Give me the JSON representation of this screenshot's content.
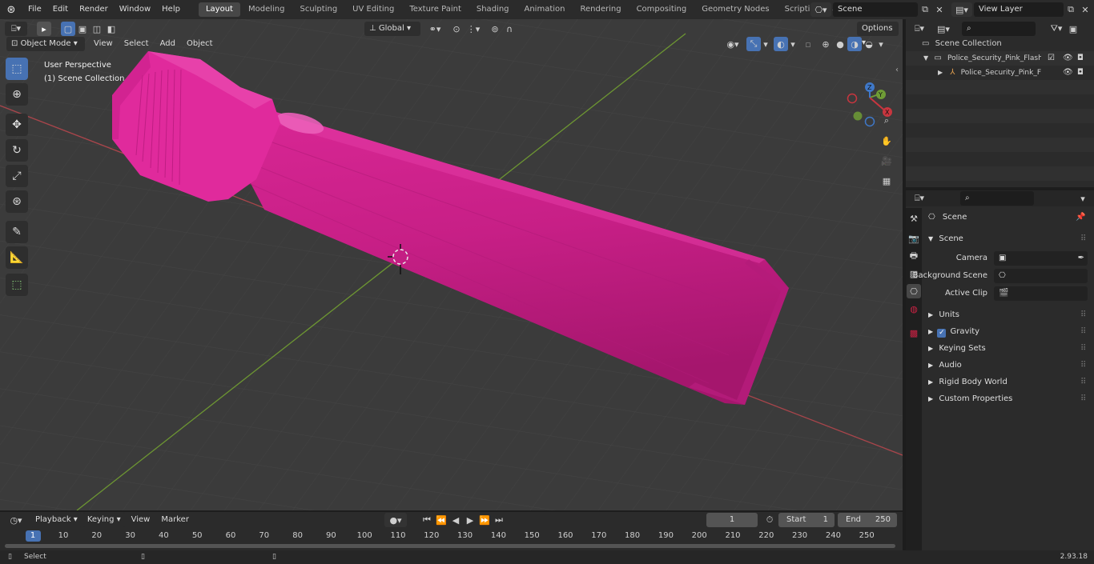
{
  "topbar": {
    "menus": [
      "File",
      "Edit",
      "Render",
      "Window",
      "Help"
    ],
    "workspaces": [
      "Layout",
      "Modeling",
      "Sculpting",
      "UV Editing",
      "Texture Paint",
      "Shading",
      "Animation",
      "Rendering",
      "Compositing",
      "Geometry Nodes",
      "Scripting"
    ],
    "active_workspace": "Layout",
    "scene": "Scene",
    "view_layer": "View Layer"
  },
  "viewport": {
    "mode": "Object Mode",
    "menus": [
      "View",
      "Select",
      "Add",
      "Object"
    ],
    "transform_orientation": "Global",
    "options": "Options",
    "overlay_title": "User Perspective",
    "overlay_subtitle": "(1) Scene Collection",
    "object_color": "#e0279c"
  },
  "outliner": {
    "root": "Scene Collection",
    "items": [
      {
        "label": "Police_Security_Pink_Flashligh"
      },
      {
        "label": "Police_Security_Pink_Flas"
      }
    ]
  },
  "properties": {
    "context_title": "Scene",
    "section_title": "Scene",
    "camera_label": "Camera",
    "background_scene_label": "Background Scene",
    "active_clip_label": "Active Clip",
    "panels": [
      "Units",
      "Gravity",
      "Keying Sets",
      "Audio",
      "Rigid Body World",
      "Custom Properties"
    ]
  },
  "timeline": {
    "menus": [
      "Playback",
      "Keying",
      "View",
      "Marker"
    ],
    "current_frame": "1",
    "start_label": "Start",
    "start_value": "1",
    "end_label": "End",
    "end_value": "250",
    "ticks": [
      "1",
      "10",
      "20",
      "30",
      "40",
      "50",
      "60",
      "70",
      "80",
      "90",
      "100",
      "110",
      "120",
      "130",
      "140",
      "150",
      "160",
      "170",
      "180",
      "190",
      "200",
      "210",
      "220",
      "230",
      "240",
      "250"
    ]
  },
  "status": {
    "left": "Select",
    "version": "2.93.18"
  }
}
